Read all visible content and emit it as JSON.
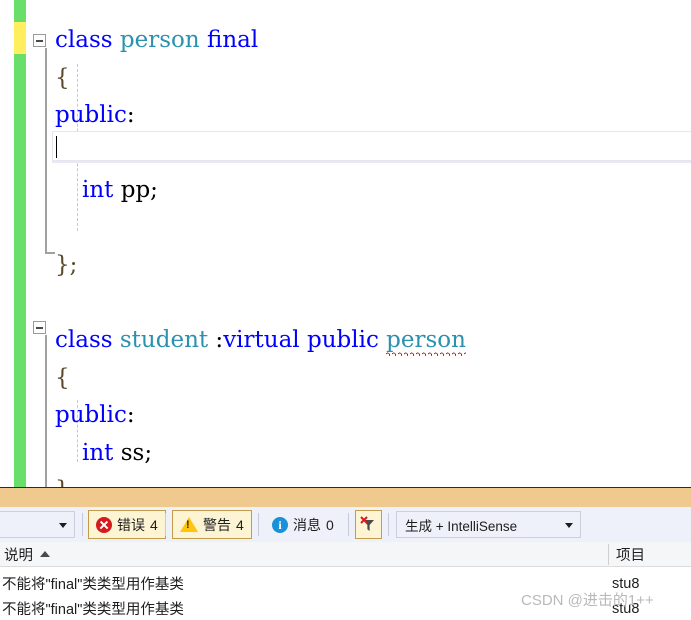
{
  "editor": {
    "language": "cpp",
    "lines": [
      {
        "indent": 0,
        "tokens": [
          {
            "t": "class",
            "c": "kw"
          },
          {
            "t": " ",
            "c": "pun"
          },
          {
            "t": "person",
            "c": "type"
          },
          {
            "t": " ",
            "c": "pun"
          },
          {
            "t": "final",
            "c": "kw"
          }
        ]
      },
      {
        "indent": 0,
        "tokens": [
          {
            "t": "{",
            "c": "brc"
          }
        ]
      },
      {
        "indent": 0,
        "tokens": [
          {
            "t": "public",
            "c": "kw"
          },
          {
            "t": ":",
            "c": "pun"
          }
        ]
      },
      {
        "indent": 0,
        "tokens": []
      },
      {
        "indent": 1,
        "tokens": [
          {
            "t": "int",
            "c": "kw"
          },
          {
            "t": " pp;",
            "c": "pun"
          }
        ]
      },
      {
        "indent": 0,
        "tokens": []
      },
      {
        "indent": 0,
        "tokens": [
          {
            "t": "};",
            "c": "brc"
          }
        ]
      },
      {
        "indent": 0,
        "tokens": []
      },
      {
        "indent": 0,
        "tokens": [
          {
            "t": "class",
            "c": "kw"
          },
          {
            "t": " ",
            "c": "pun"
          },
          {
            "t": "student",
            "c": "type"
          },
          {
            "t": " :",
            "c": "pun"
          },
          {
            "t": "virtual",
            "c": "kw"
          },
          {
            "t": " ",
            "c": "pun"
          },
          {
            "t": "public",
            "c": "kw"
          },
          {
            "t": " ",
            "c": "pun"
          },
          {
            "t": "person",
            "c": "type",
            "err": true
          }
        ]
      },
      {
        "indent": 0,
        "tokens": [
          {
            "t": "{",
            "c": "brc"
          }
        ]
      },
      {
        "indent": 0,
        "tokens": [
          {
            "t": "public",
            "c": "kw"
          },
          {
            "t": ":",
            "c": "pun"
          }
        ]
      },
      {
        "indent": 1,
        "tokens": [
          {
            "t": "int",
            "c": "kw"
          },
          {
            "t": " ss;",
            "c": "pun"
          }
        ]
      },
      {
        "indent": 0,
        "tokens": [
          {
            "t": "};",
            "c": "brc"
          }
        ]
      }
    ],
    "colors": {
      "keyword": "#0000ff",
      "type": "#2b91af",
      "plain": "#000000",
      "error_squiggle": "#ee0000",
      "track_saved": "#69df6b",
      "track_unsaved": "#ffee5e",
      "current_line_border": "#e6e6f0"
    },
    "fold_regions": [
      {
        "label": "fold-person-class",
        "state": "expanded"
      },
      {
        "label": "fold-student-class",
        "state": "expanded"
      }
    ]
  },
  "error_list": {
    "toolbar": {
      "scope_filter_value": "",
      "errors_label": "错误",
      "errors_count": "4",
      "warnings_label": "警告",
      "warnings_count": "4",
      "messages_label": "消息",
      "messages_count": "0",
      "clear_filter_title": "清除筛选器",
      "build_filter_value": "生成 + IntelliSense"
    },
    "columns": [
      {
        "key": "description",
        "label": "说明",
        "sort": "asc"
      },
      {
        "key": "project",
        "label": "项目",
        "sort": "none"
      }
    ],
    "rows": [
      {
        "description": "不能将\"final\"类类型用作基类",
        "project": "stu8"
      },
      {
        "description": "不能将\"final\"类类型用作基类",
        "project": "stu8"
      }
    ]
  },
  "watermark": {
    "text": "CSDN @进击的1++"
  }
}
